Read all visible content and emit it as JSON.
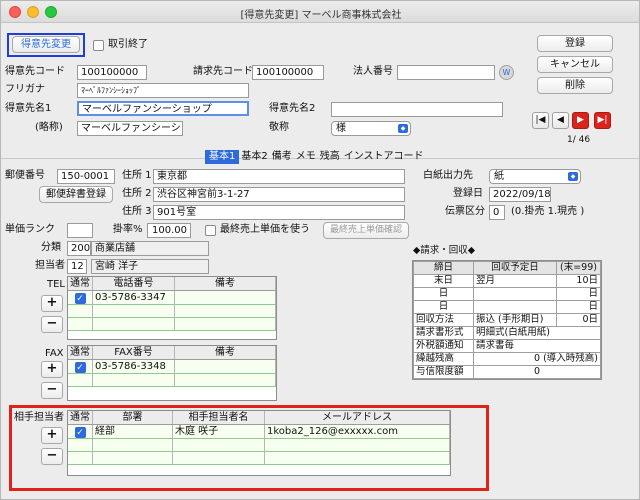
{
  "window": {
    "title": "[得意先変更] マーベル商事株式会社"
  },
  "mode_button": "得意先変更",
  "torihiki_shuryo": "取引終了",
  "actions": {
    "register": "登録",
    "cancel": "キャンセル",
    "delete": "削除"
  },
  "header": {
    "code_label": "得意先コード",
    "code_value": "100100000",
    "bill_code_label": "請求先コード",
    "bill_code_value": "100100000",
    "corp_no_label": "法人番号",
    "corp_no_value": "",
    "furigana_label": "フリガナ",
    "furigana_value": "ﾏｰﾍﾞﾙﾌｧﾝｼｰｼｮｯﾌﾟ",
    "name1_label": "得意先名1",
    "name1_value": "マーベルファンシーショップ",
    "name2_label": "得意先名2",
    "name2_value": "",
    "short_label": "(略称)",
    "short_value": "マーベルファンシーショ",
    "honorific_label": "敬称",
    "honorific_value": "様",
    "web_icon_text": "W",
    "record_pos": "1/ 46"
  },
  "tabs": [
    "基本1",
    "基本2",
    "備考",
    "メモ",
    "残高",
    "インストアコード"
  ],
  "basic": {
    "zip_label": "郵便番号",
    "zip_value": "150-0001",
    "zip_btn": "郵便辞書登録",
    "addr1_label": "住所 1",
    "addr1_value": "東京都",
    "addr2_label": "住所 2",
    "addr2_value": "渋谷区神宮前3-1-27",
    "addr3_label": "住所 3",
    "addr3_value": "901号室",
    "paper_label": "白紙出力先",
    "paper_value": "紙",
    "regdate_label": "登録日",
    "regdate_value": "2022/09/18",
    "slip_label": "伝票区分",
    "slip_value": "0",
    "slip_note": "(0.掛売 1.現売 )",
    "price_rank_label": "単価ランク",
    "price_rank_value": "",
    "rate_label": "掛率%",
    "rate_value": "100.00",
    "last_price_label": "最終売上単価を使う",
    "last_price_btn": "最終売上単価確認",
    "category_label": "分類",
    "category_code": "200",
    "category_name": "商業店舗",
    "staff_label": "担当者",
    "staff_code": "12",
    "staff_name": "宮崎 洋子"
  },
  "tel": {
    "label": "TEL",
    "headers": [
      "通常",
      "電話番号",
      "備考"
    ],
    "rows": [
      {
        "checked": true,
        "number": "03-5786-3347",
        "note": ""
      }
    ]
  },
  "fax": {
    "label": "FAX",
    "headers": [
      "通常",
      "FAX番号",
      "備考"
    ],
    "rows": [
      {
        "checked": true,
        "number": "03-5786-3348",
        "note": ""
      }
    ]
  },
  "contact": {
    "label": "相手担当者",
    "headers": [
      "通常",
      "部署",
      "相手担当者名",
      "メールアドレス"
    ],
    "rows": [
      {
        "checked": true,
        "dept": "経部",
        "name": "木庭 咲子",
        "email": "1koba2_126@exxxxx.com"
      }
    ]
  },
  "billing": {
    "title": "◆請求・回収◆",
    "h_close": "締日",
    "h_due": "回収予定日",
    "h_max": "(末=99)",
    "r1": [
      "末日",
      "翌月",
      "10日"
    ],
    "r2": [
      "日",
      "",
      "日"
    ],
    "r3": [
      "日",
      "",
      "日"
    ],
    "method_label": "回収方法",
    "method_value": "振込 (手形期日)",
    "method_days": "0日",
    "format_label": "請求書形式",
    "format_value": "明細式(白紙用紙)",
    "tax_label": "外税額通知",
    "tax_value": "請求書毎",
    "carry_label": "繰越残高",
    "carry_value": "0 (導入時残高)",
    "credit_label": "与信限度額",
    "credit_value": "0"
  },
  "colors": {
    "accent": "#2d6bdc",
    "highlight": "#e0221c",
    "row_green": "#f6fff0"
  },
  "icons": {
    "plus": "+",
    "minus": "−",
    "check": "✓",
    "first": "|◀",
    "prev": "◀",
    "next": "▶",
    "last": "▶|"
  }
}
